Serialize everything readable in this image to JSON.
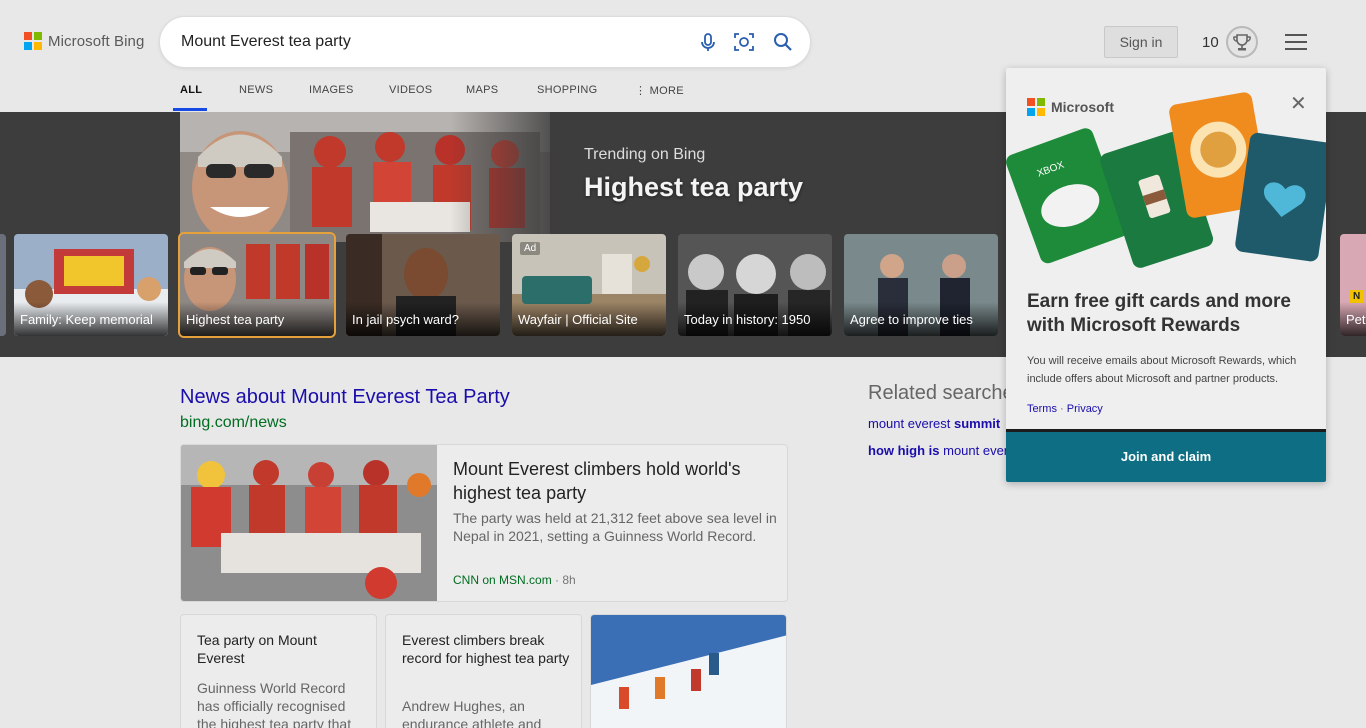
{
  "header": {
    "logo_text": "Microsoft Bing",
    "search_query": "Mount Everest tea party",
    "sign_in": "Sign in",
    "points": "10"
  },
  "tabs": [
    {
      "label": "ALL",
      "active": true
    },
    {
      "label": "NEWS"
    },
    {
      "label": "IMAGES"
    },
    {
      "label": "VIDEOS"
    },
    {
      "label": "MAPS"
    },
    {
      "label": "SHOPPING"
    },
    {
      "label": "MORE"
    }
  ],
  "trending": {
    "label": "Trending on Bing",
    "title": "Highest tea party",
    "cards": [
      {
        "label": "Family: Keep memorial"
      },
      {
        "label": "Highest tea party",
        "selected": true
      },
      {
        "label": "In jail psych ward?"
      },
      {
        "label": "Wayfair | Official Site",
        "ad": "Ad"
      },
      {
        "label": "Today in history: 1950"
      },
      {
        "label": "Agree to improve ties"
      },
      {
        "label": "Pet"
      }
    ]
  },
  "news": {
    "title": "News about Mount Everest Tea Party",
    "source": "bing.com/news",
    "main": {
      "title": "Mount Everest climbers hold world's highest tea party",
      "desc": "The party was held at 21,312 feet above sea level in Nepal in 2021, setting a Guinness World Record.",
      "source": "CNN on MSN.com",
      "time": "· 8h"
    },
    "cards": [
      {
        "title": "Tea party on Mount Everest",
        "desc": "Guinness World Record has officially recognised the highest tea party that"
      },
      {
        "title": "Everest climbers break record for highest tea party",
        "desc": "Andrew Hughes, an endurance athlete and"
      }
    ]
  },
  "related": {
    "title": "Related searches",
    "items": [
      {
        "plain": "mount everest ",
        "bold": "summit"
      },
      {
        "bold": "how high is ",
        "plain": "mount everest"
      }
    ]
  },
  "rewards_popup": {
    "brand": "Microsoft",
    "heading": "Earn free gift cards and more with Microsoft Rewards",
    "text": "You will receive emails about Microsoft Rewards, which include offers about Microsoft and partner products.",
    "terms": "Terms",
    "privacy": "Privacy",
    "separator": "·",
    "button": "Join and claim",
    "close": "✕"
  },
  "badge_new": "N",
  "colors": {
    "ms_red": "#f25022",
    "ms_green": "#7fba00",
    "ms_blue": "#00a4ef",
    "ms_yellow": "#ffb900",
    "link": "#1a0dab",
    "source_green": "#006d21",
    "accent_button": "#0e6f84"
  }
}
